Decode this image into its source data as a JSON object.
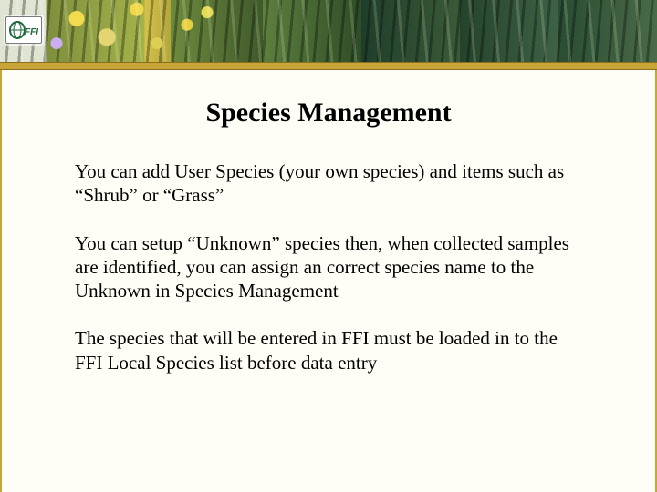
{
  "logo_text": "FFI",
  "title": "Species Management",
  "paragraphs": {
    "p0": "You can add User Species (your own species) and items such as “Shrub” or “Grass”",
    "p1": "You can setup “Unknown” species then, when collected samples are identified, you can assign an correct species name to the Unknown in Species Management",
    "p2": "The species that will be entered in FFI must be loaded in to the FFI Local Species list before data entry"
  }
}
